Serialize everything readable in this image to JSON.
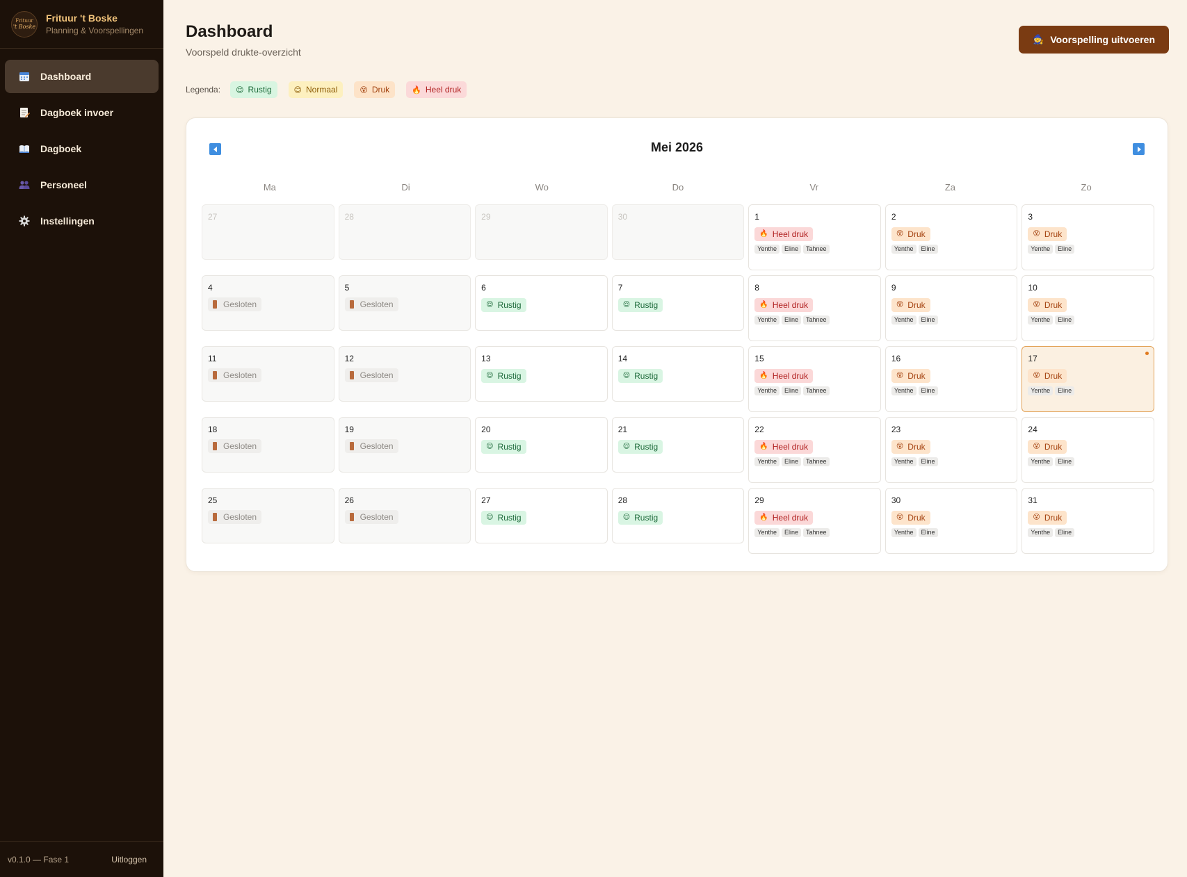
{
  "brand": {
    "name": "Frituur 't Boske",
    "subtitle": "Planning & Voorspellingen",
    "logo_line1": "Frituur",
    "logo_line2": "'t Boske"
  },
  "nav": [
    {
      "label": "Dashboard",
      "icon": "calendar-icon",
      "active": true
    },
    {
      "label": "Dagboek invoer",
      "icon": "memo-icon",
      "active": false
    },
    {
      "label": "Dagboek",
      "icon": "book-icon",
      "active": false
    },
    {
      "label": "Personeel",
      "icon": "people-icon",
      "active": false
    },
    {
      "label": "Instellingen",
      "icon": "gear-icon",
      "active": false
    }
  ],
  "footer": {
    "version": "v0.1.0 — Fase 1",
    "logout": "Uitloggen"
  },
  "header": {
    "title": "Dashboard",
    "subtitle": "Voorspeld drukte-overzicht",
    "run_button": "Voorspelling uitvoeren"
  },
  "legend": {
    "label": "Legenda:",
    "items": [
      {
        "label": "Rustig",
        "level": "rustig"
      },
      {
        "label": "Normaal",
        "level": "normaal"
      },
      {
        "label": "Druk",
        "level": "druk"
      },
      {
        "label": "Heel druk",
        "level": "heel"
      }
    ]
  },
  "calendar": {
    "month_title": "Mei 2026",
    "weekdays": [
      "Ma",
      "Di",
      "Wo",
      "Do",
      "Vr",
      "Za",
      "Zo"
    ],
    "weeks": [
      [
        {
          "day": "27",
          "muted": true
        },
        {
          "day": "28",
          "muted": true
        },
        {
          "day": "29",
          "muted": true
        },
        {
          "day": "30",
          "muted": true
        },
        {
          "day": "1",
          "status": "Heel druk",
          "level": "heel",
          "staff": [
            "Yenthe",
            "Eline",
            "Tahnee"
          ]
        },
        {
          "day": "2",
          "status": "Druk",
          "level": "druk",
          "staff": [
            "Yenthe",
            "Eline"
          ]
        },
        {
          "day": "3",
          "status": "Druk",
          "level": "druk",
          "staff": [
            "Yenthe",
            "Eline"
          ]
        }
      ],
      [
        {
          "day": "4",
          "status": "Gesloten",
          "level": "closed"
        },
        {
          "day": "5",
          "status": "Gesloten",
          "level": "closed"
        },
        {
          "day": "6",
          "status": "Rustig",
          "level": "rustig"
        },
        {
          "day": "7",
          "status": "Rustig",
          "level": "rustig"
        },
        {
          "day": "8",
          "status": "Heel druk",
          "level": "heel",
          "staff": [
            "Yenthe",
            "Eline",
            "Tahnee"
          ]
        },
        {
          "day": "9",
          "status": "Druk",
          "level": "druk",
          "staff": [
            "Yenthe",
            "Eline"
          ]
        },
        {
          "day": "10",
          "status": "Druk",
          "level": "druk",
          "staff": [
            "Yenthe",
            "Eline"
          ]
        }
      ],
      [
        {
          "day": "11",
          "status": "Gesloten",
          "level": "closed"
        },
        {
          "day": "12",
          "status": "Gesloten",
          "level": "closed"
        },
        {
          "day": "13",
          "status": "Rustig",
          "level": "rustig"
        },
        {
          "day": "14",
          "status": "Rustig",
          "level": "rustig"
        },
        {
          "day": "15",
          "status": "Heel druk",
          "level": "heel",
          "staff": [
            "Yenthe",
            "Eline",
            "Tahnee"
          ]
        },
        {
          "day": "16",
          "status": "Druk",
          "level": "druk",
          "staff": [
            "Yenthe",
            "Eline"
          ]
        },
        {
          "day": "17",
          "status": "Druk",
          "level": "druk",
          "staff": [
            "Yenthe",
            "Eline"
          ],
          "today": true
        }
      ],
      [
        {
          "day": "18",
          "status": "Gesloten",
          "level": "closed"
        },
        {
          "day": "19",
          "status": "Gesloten",
          "level": "closed"
        },
        {
          "day": "20",
          "status": "Rustig",
          "level": "rustig"
        },
        {
          "day": "21",
          "status": "Rustig",
          "level": "rustig"
        },
        {
          "day": "22",
          "status": "Heel druk",
          "level": "heel",
          "staff": [
            "Yenthe",
            "Eline",
            "Tahnee"
          ]
        },
        {
          "day": "23",
          "status": "Druk",
          "level": "druk",
          "staff": [
            "Yenthe",
            "Eline"
          ]
        },
        {
          "day": "24",
          "status": "Druk",
          "level": "druk",
          "staff": [
            "Yenthe",
            "Eline"
          ]
        }
      ],
      [
        {
          "day": "25",
          "status": "Gesloten",
          "level": "closed"
        },
        {
          "day": "26",
          "status": "Gesloten",
          "level": "closed"
        },
        {
          "day": "27",
          "status": "Rustig",
          "level": "rustig"
        },
        {
          "day": "28",
          "status": "Rustig",
          "level": "rustig"
        },
        {
          "day": "29",
          "status": "Heel druk",
          "level": "heel",
          "staff": [
            "Yenthe",
            "Eline",
            "Tahnee"
          ]
        },
        {
          "day": "30",
          "status": "Druk",
          "level": "druk",
          "staff": [
            "Yenthe",
            "Eline"
          ]
        },
        {
          "day": "31",
          "status": "Druk",
          "level": "druk",
          "staff": [
            "Yenthe",
            "Eline"
          ]
        }
      ]
    ]
  }
}
